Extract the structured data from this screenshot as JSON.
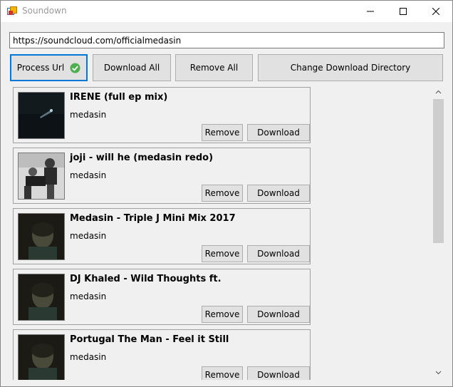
{
  "window": {
    "title": "Soundown",
    "icon": "app-icon"
  },
  "url_input": {
    "value": "https://soundcloud.com/officialmedasin"
  },
  "toolbar": {
    "process_label": "Process Url",
    "download_all_label": "Download All",
    "remove_all_label": "Remove All",
    "change_dir_label": "Change Download Directory"
  },
  "tracks": [
    {
      "title": "IRENE (full ep mix)",
      "artist": "medasin",
      "remove": "Remove",
      "download": "Download"
    },
    {
      "title": "joji - will he (medasin redo)",
      "artist": "medasin",
      "remove": "Remove",
      "download": "Download"
    },
    {
      "title": "Medasin - Triple J Mini Mix 2017",
      "artist": "medasin",
      "remove": "Remove",
      "download": "Download"
    },
    {
      "title": "DJ Khaled - Wild Thoughts ft.",
      "artist": "medasin",
      "remove": "Remove",
      "download": "Download"
    },
    {
      "title": "Portugal The Man - Feel it Still",
      "artist": "medasin",
      "remove": "Remove",
      "download": "Download"
    }
  ],
  "colors": {
    "accent": "#0078d7",
    "check": "#4caf50",
    "button_bg": "#e1e1e1"
  }
}
